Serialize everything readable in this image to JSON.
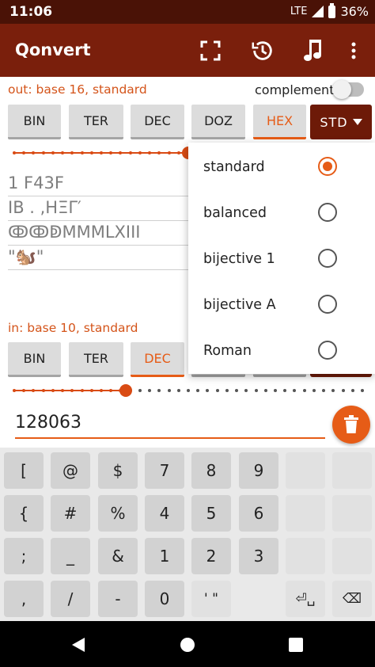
{
  "status": {
    "time": "11:06",
    "network": "LTE",
    "battery": "36%"
  },
  "appbar": {
    "title": "Qonvert",
    "icons": [
      "fullscreen-icon",
      "history-icon",
      "music-note-icon",
      "more-vert-icon"
    ]
  },
  "output": {
    "label": "out: base 16, standard",
    "complement_label": "complement",
    "complement_on": false,
    "bases": [
      "BIN",
      "TER",
      "DEC",
      "DOZ",
      "HEX"
    ],
    "active_base": "HEX",
    "system_button": "STD",
    "slider_fraction": 0.5,
    "results": [
      "1 F43F",
      "IB . ,ΗΞΓ′",
      "ↂↂↁMMMLXIII",
      "\"🐿️\""
    ]
  },
  "input": {
    "label": "in: base 10, standard",
    "bases": [
      "BIN",
      "TER",
      "DEC"
    ],
    "active_base": "DEC",
    "slider_fraction": 0.32,
    "value": "128063"
  },
  "menu": {
    "options": [
      "standard",
      "balanced",
      "bijective 1",
      "bijective A",
      "Roman"
    ],
    "selected": "standard"
  },
  "keyboard": {
    "rows": [
      [
        "[",
        "@",
        "$",
        "7",
        "8",
        "9",
        "",
        ""
      ],
      [
        "{",
        "#",
        "%",
        "4",
        "5",
        "6",
        "",
        ""
      ],
      [
        ";",
        "_",
        "&",
        "1",
        "2",
        "3",
        "",
        ""
      ],
      [
        ",",
        "/",
        "-",
        "0",
        "' \"",
        "⏎␣",
        "⌫"
      ]
    ]
  },
  "colors": {
    "appbar": "#7a1f0c",
    "statusbar": "#4a1206",
    "accent": "#e65c17",
    "std_button": "#6d1a08"
  }
}
